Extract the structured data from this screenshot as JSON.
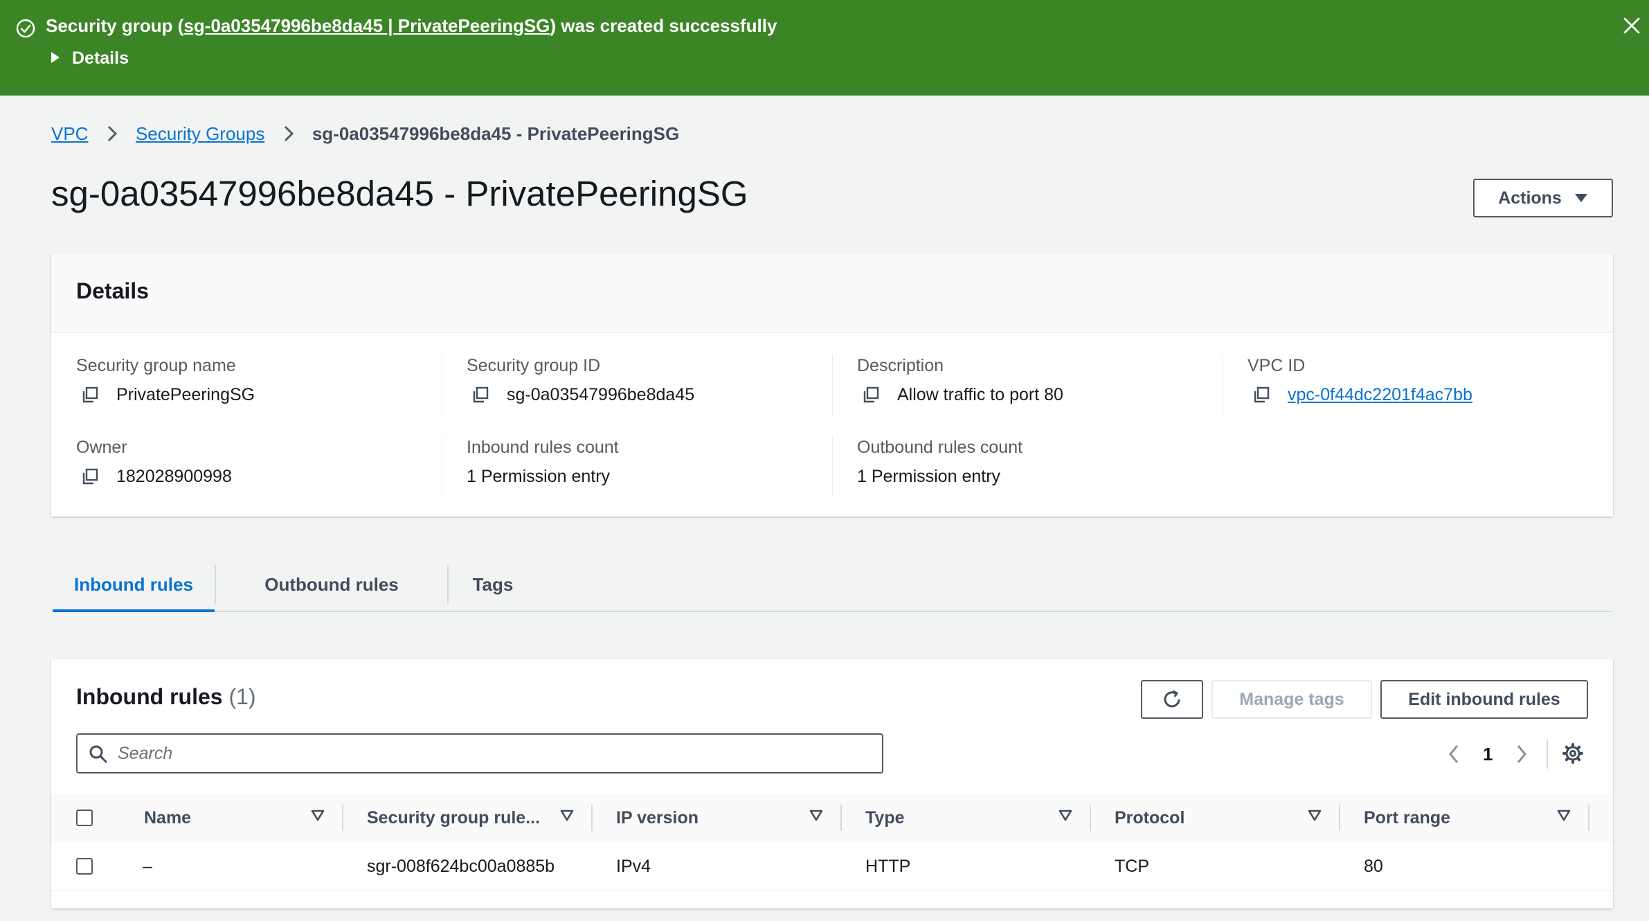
{
  "flash": {
    "msg_prefix": "Security group (",
    "msg_link": "sg-0a03547996be8da45 | PrivatePeeringSG",
    "msg_suffix": ") was created successfully",
    "details_label": "Details",
    "color": "#3b8526"
  },
  "breadcrumb": {
    "items": [
      "VPC",
      "Security Groups"
    ],
    "current": "sg-0a03547996be8da45 - PrivatePeeringSG"
  },
  "page": {
    "title": "sg-0a03547996be8da45 - PrivatePeeringSG",
    "actions_label": "Actions"
  },
  "details": {
    "heading": "Details",
    "fields": {
      "sg_name_label": "Security group name",
      "sg_name": "PrivatePeeringSG",
      "sg_id_label": "Security group ID",
      "sg_id": "sg-0a03547996be8da45",
      "description_label": "Description",
      "description": "Allow traffic to port 80",
      "vpc_id_label": "VPC ID",
      "vpc_id": "vpc-0f44dc2201f4ac7bb",
      "owner_label": "Owner",
      "owner": "182028900998",
      "inbound_count_label": "Inbound rules count",
      "inbound_count": "1 Permission entry",
      "outbound_count_label": "Outbound rules count",
      "outbound_count": "1 Permission entry"
    }
  },
  "tabs": [
    "Inbound rules",
    "Outbound rules",
    "Tags"
  ],
  "rules": {
    "heading": "Inbound rules",
    "count": "(1)",
    "manage_tags_label": "Manage tags",
    "edit_label": "Edit inbound rules",
    "search_placeholder": "Search",
    "page_number": "1",
    "columns": [
      "Name",
      "Security group rule...",
      "IP version",
      "Type",
      "Protocol",
      "Port range"
    ],
    "rows": [
      [
        "–",
        "sgr-008f624bc00a0885b",
        "IPv4",
        "HTTP",
        "TCP",
        "80"
      ]
    ]
  },
  "colors": {
    "link": "#0972d3",
    "success": "#3b8526"
  },
  "icons": [
    "check-circle-icon",
    "caret-right-icon",
    "close-icon",
    "chevron-right-icon",
    "caret-down-icon",
    "copy-icon",
    "refresh-icon",
    "search-icon",
    "chevron-left-icon",
    "settings-gear-icon",
    "sort-filter-icon"
  ]
}
